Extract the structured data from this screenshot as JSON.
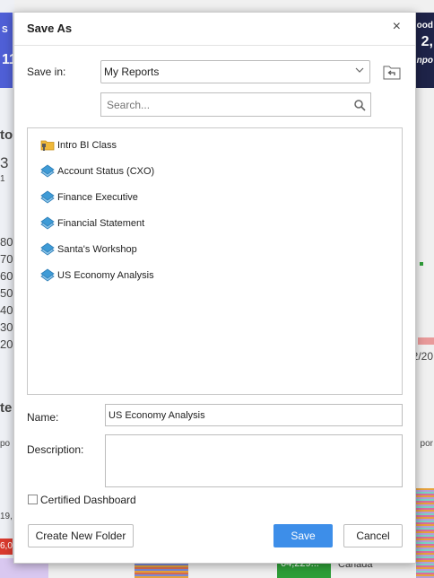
{
  "dialog": {
    "title": "Save As",
    "close_glyph": "×",
    "save_in": {
      "label": "Save in:",
      "value": "My Reports"
    },
    "search": {
      "placeholder": "Search..."
    },
    "items": [
      {
        "name": "Intro BI Class",
        "icon": "folder-icon"
      },
      {
        "name": "Account Status (CXO)",
        "icon": "dashboard-icon"
      },
      {
        "name": "Finance Executive",
        "icon": "dashboard-icon"
      },
      {
        "name": "Financial Statement",
        "icon": "dashboard-icon"
      },
      {
        "name": "Santa's Workshop",
        "icon": "dashboard-icon"
      },
      {
        "name": "US Economy Analysis",
        "icon": "dashboard-icon"
      }
    ],
    "name": {
      "label": "Name:",
      "value": "US Economy Analysis"
    },
    "description": {
      "label": "Description:",
      "value": ""
    },
    "certified": {
      "label": "Certified Dashboard",
      "checked": false
    },
    "buttons": {
      "new_folder": "Create New Folder",
      "save": "Save",
      "cancel": "Cancel"
    }
  },
  "background": {
    "left_numbers": [
      "80",
      "70",
      "60",
      "50",
      "40",
      "30",
      "20"
    ],
    "left_fragments": [
      "11",
      "3",
      "1",
      "19,",
      "6,0"
    ],
    "right_fragments": [
      "ood",
      "2,",
      "npo",
      "2/20"
    ],
    "bottom_value": "64,229...",
    "bottom_country": "Canada"
  },
  "colors": {
    "accent": "#3d8ee9",
    "dashboard_icon": "#3f9bd6",
    "folder_icon": "#f0b93a"
  }
}
